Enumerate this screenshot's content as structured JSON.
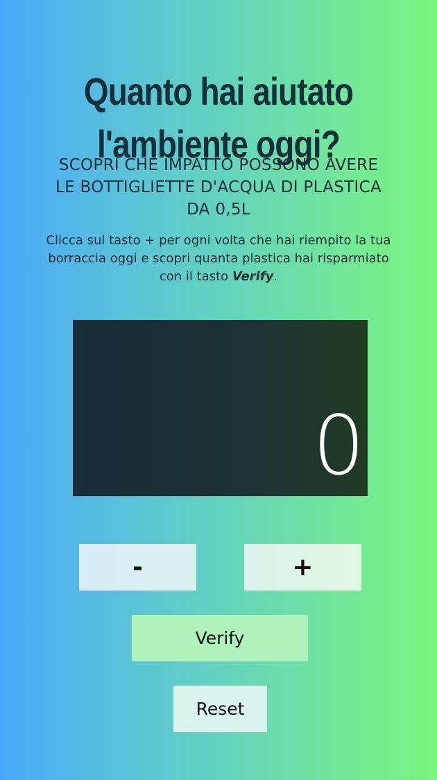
{
  "header": {
    "title_line1": "Quanto hai aiutato",
    "title_line2": "l'ambiente oggi?",
    "subtitle": "SCOPRI CHE IMPATTO POSSONO AVERE LE BOTTIGLIETTE D'ACQUA DI PLASTICA DA 0,5L",
    "description_prefix": "Clicca sul tasto + per ogni volta che hai riempito la tua borraccia oggi e scopri quanta plastica hai risparmiato con il tasto ",
    "description_emphasis": "Verify",
    "description_suffix": "."
  },
  "counter": {
    "value": "0"
  },
  "controls": {
    "minus_label": "-",
    "plus_label": "+",
    "verify_label": "Verify",
    "reset_label": "Reset"
  },
  "colors": {
    "gradient_left": "#4aa8fb",
    "gradient_right": "#7af57c",
    "display_background": "#1d3233",
    "title_color": "#15303a",
    "verify_button": "#aff2bb",
    "reset_button": "#d7f3ec"
  }
}
